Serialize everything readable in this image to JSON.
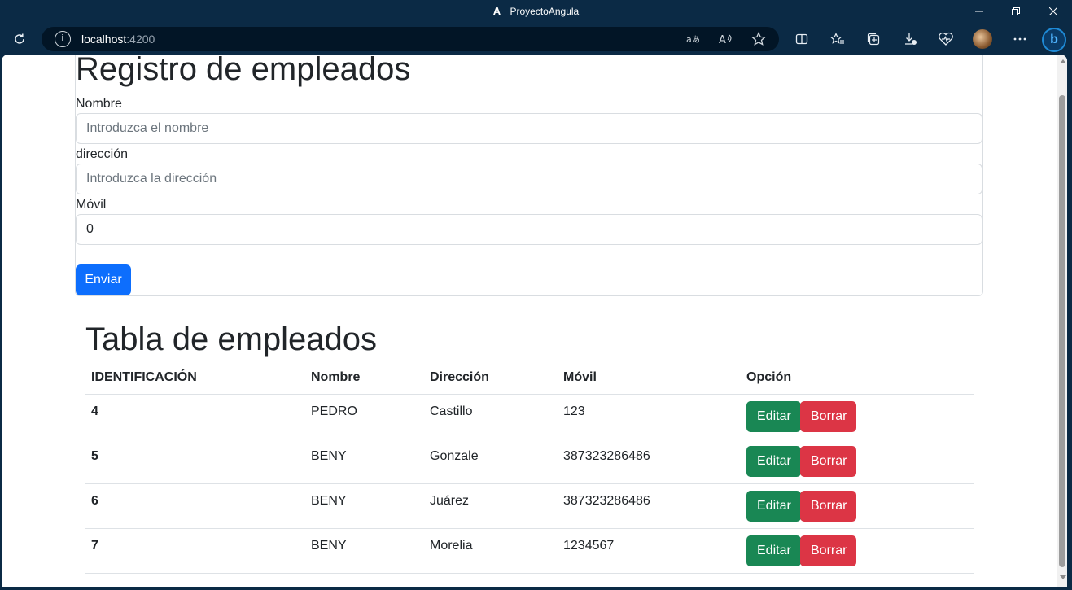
{
  "window": {
    "title": "ProyectoAngula",
    "app_logo": "A"
  },
  "browser": {
    "address_host": "localhost",
    "address_port": ":4200",
    "toolbar_icons": [
      "refresh-icon",
      "info-icon",
      "translate-icon",
      "read-aloud-icon",
      "favorite-star-icon",
      "split-screen-icon",
      "favorites-icon",
      "collections-icon",
      "downloads-icon",
      "browser-essentials-icon",
      "profile-avatar",
      "more-icon",
      "bing-copilot-icon"
    ]
  },
  "form": {
    "title": "Registro de empleados",
    "name_label": "Nombre",
    "name_placeholder": "Introduzca el nombre",
    "address_label": "dirección",
    "address_placeholder": "Introduzca la dirección",
    "mobile_label": "Móvil",
    "mobile_value": "0",
    "submit_label": "Enviar"
  },
  "table": {
    "title": "Tabla de empleados",
    "headers": {
      "id": "IDENTIFICACIÓN",
      "name": "Nombre",
      "address": "Dirección",
      "mobile": "Móvil",
      "option": "Opción"
    },
    "rows": [
      {
        "id": "4",
        "name": "PEDRO",
        "address": "Castillo",
        "mobile": "123",
        "edit": "Editar",
        "delete": "Borrar"
      },
      {
        "id": "5",
        "name": "BENY",
        "address": "Gonzale",
        "mobile": "387323286486",
        "edit": "Editar",
        "delete": "Borrar"
      },
      {
        "id": "6",
        "name": "BENY",
        "address": "Juárez",
        "mobile": "387323286486",
        "edit": "Editar",
        "delete": "Borrar"
      },
      {
        "id": "7",
        "name": "BENY",
        "address": "Morelia",
        "mobile": "1234567",
        "edit": "Editar",
        "delete": "Borrar"
      }
    ]
  },
  "colors": {
    "primary": "#0d6efd",
    "success": "#198754",
    "danger": "#dc3545",
    "chrome": "#0b2a45"
  }
}
